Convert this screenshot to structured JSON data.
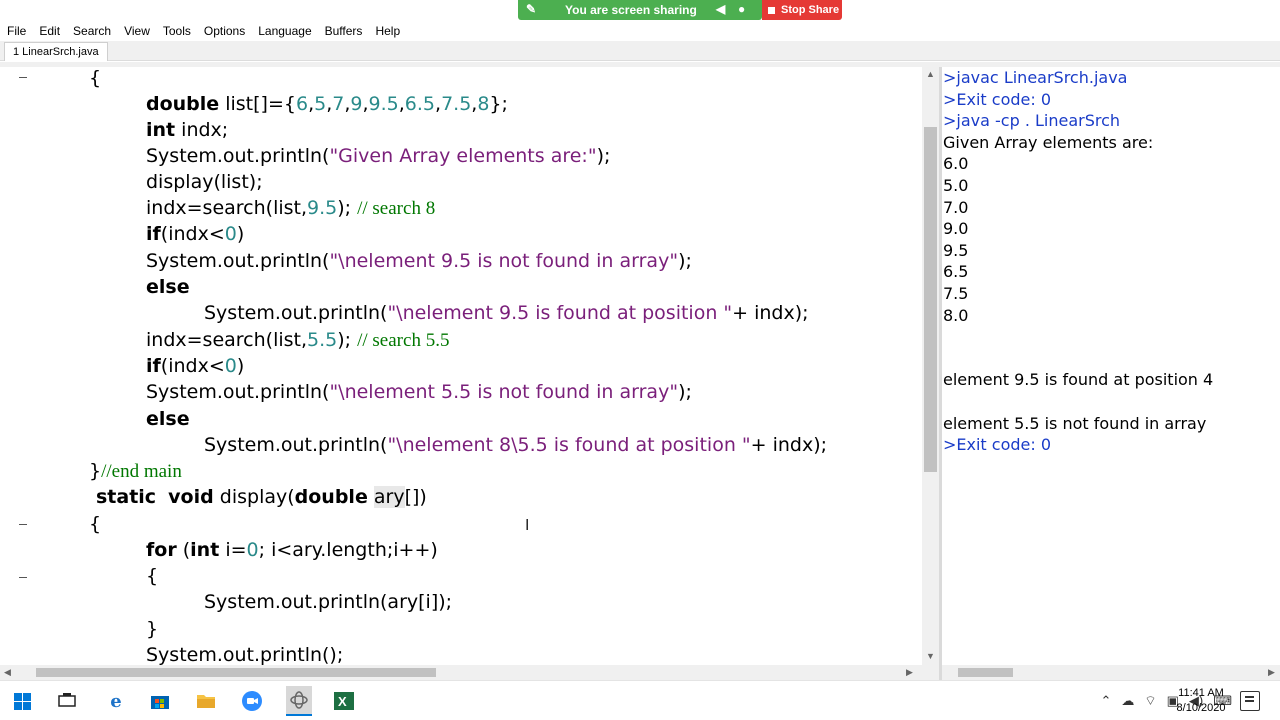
{
  "share_bar": {
    "sharing_text": "You are screen sharing",
    "stop_label": "Stop Share",
    "pill_color": "#4caf50",
    "stop_color": "#e53935"
  },
  "menu": [
    "File",
    "Edit",
    "Search",
    "View",
    "Tools",
    "Options",
    "Language",
    "Buffers",
    "Help"
  ],
  "tab": {
    "label": "1 LinearSrch.java"
  },
  "editor": {
    "lines": [
      "{",
      "double list[]={6,5,7,9,9.5,6.5,7.5,8};",
      "int indx;",
      "System.out.println(\"Given Array elements are:\");",
      "display(list);",
      "indx=search(list,9.5); // search 8",
      "if(indx<0)",
      "System.out.println(\"\\nelement 9.5 is not found in array\");",
      "else",
      "System.out.println(\"\\nelement 9.5 is found at position \"+ indx);",
      "indx=search(list,5.5); // search 5.5",
      "if(indx<0)",
      "System.out.println(\"\\nelement 5.5 is not found in array\");",
      "else",
      "System.out.println(\"\\nelement 8\\5.5 is found at position \"+ indx);",
      "}//end main",
      "static  void display(double ary[])",
      "{",
      "for (int i=0; i<ary.length;i++)",
      "{",
      "System.out.println(ary[i]);",
      "}",
      "System.out.println();"
    ]
  },
  "output": {
    "lines": [
      ">javac LinearSrch.java",
      ">Exit code: 0",
      ">java -cp . LinearSrch",
      "Given Array elements are:",
      "6.0",
      "5.0",
      "7.0",
      "9.0",
      "9.5",
      "6.5",
      "7.5",
      "8.0",
      "",
      "",
      "element 9.5 is found at position 4",
      "",
      "element 5.5 is not found in array",
      ">Exit code: 0"
    ]
  },
  "colors": {
    "keyword": "#000000",
    "number": "#2a8a8a",
    "string": "#7a1f7a",
    "comment": "#007700",
    "output_system": "#1a3cc8"
  },
  "taskbar": {
    "icons": [
      "windows-start-icon",
      "task-view-icon",
      "edge-icon",
      "store-icon",
      "file-explorer-icon",
      "zoom-icon",
      "scite-icon",
      "excel-icon"
    ],
    "time": "11:41 AM",
    "date": "8/10/2020"
  }
}
